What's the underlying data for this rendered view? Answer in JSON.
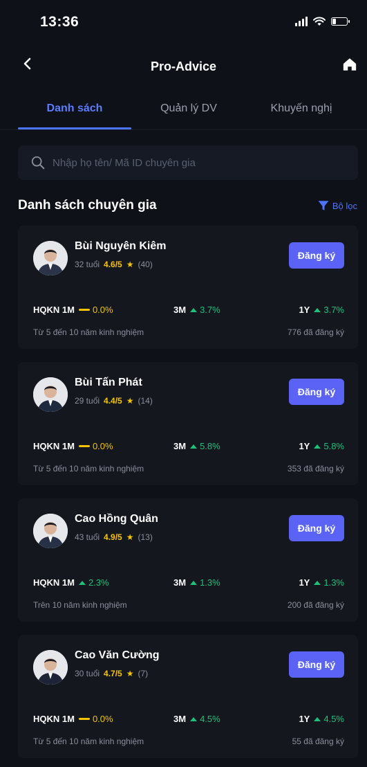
{
  "status_bar": {
    "time": "13:36"
  },
  "header": {
    "title": "Pro-Advice"
  },
  "tabs": [
    {
      "label": "Danh sách",
      "active": true
    },
    {
      "label": "Quản lý DV",
      "active": false
    },
    {
      "label": "Khuyến nghị",
      "active": false
    }
  ],
  "search": {
    "placeholder": "Nhập họ tên/ Mã ID chuyên gia"
  },
  "section": {
    "title": "Danh sách chuyên gia",
    "filter_label": "Bộ lọc"
  },
  "colors": {
    "accent": "#4d74ff",
    "button": "#5a63f5",
    "positive": "#1fc07a",
    "neutral": "#f5c400"
  },
  "experts": [
    {
      "name": "Bùi Nguyên Kiêm",
      "age": "32 tuổi",
      "rating": "4.6/5",
      "reviews": "(40)",
      "button": "Đăng ký",
      "m1_label": "HQKN 1M",
      "m1": "0.0%",
      "m1_trend": "flat",
      "m3_label": "3M",
      "m3": "3.7%",
      "y1_label": "1Y",
      "y1": "3.7%",
      "experience": "Từ 5 đến 10 năm kinh nghiệm",
      "registered": "776 đã đăng ký"
    },
    {
      "name": "Bùi Tấn Phát",
      "age": "29 tuổi",
      "rating": "4.4/5",
      "reviews": "(14)",
      "button": "Đăng ký",
      "m1_label": "HQKN 1M",
      "m1": "0.0%",
      "m1_trend": "flat",
      "m3_label": "3M",
      "m3": "5.8%",
      "y1_label": "1Y",
      "y1": "5.8%",
      "experience": "Từ 5 đến 10 năm kinh nghiệm",
      "registered": "353 đã đăng ký"
    },
    {
      "name": "Cao Hồng Quân",
      "age": "43 tuổi",
      "rating": "4.9/5",
      "reviews": "(13)",
      "button": "Đăng ký",
      "m1_label": "HQKN 1M",
      "m1": "2.3%",
      "m1_trend": "up",
      "m3_label": "3M",
      "m3": "1.3%",
      "y1_label": "1Y",
      "y1": "1.3%",
      "experience": "Trên 10 năm kinh nghiệm",
      "registered": "200 đã đăng ký"
    },
    {
      "name": "Cao Văn Cường",
      "age": "30 tuổi",
      "rating": "4.7/5",
      "reviews": "(7)",
      "button": "Đăng ký",
      "m1_label": "HQKN 1M",
      "m1": "0.0%",
      "m1_trend": "flat",
      "m3_label": "3M",
      "m3": "4.5%",
      "y1_label": "1Y",
      "y1": "4.5%",
      "experience": "Từ 5 đến 10 năm kinh nghiệm",
      "registered": "55 đã đăng ký"
    }
  ]
}
